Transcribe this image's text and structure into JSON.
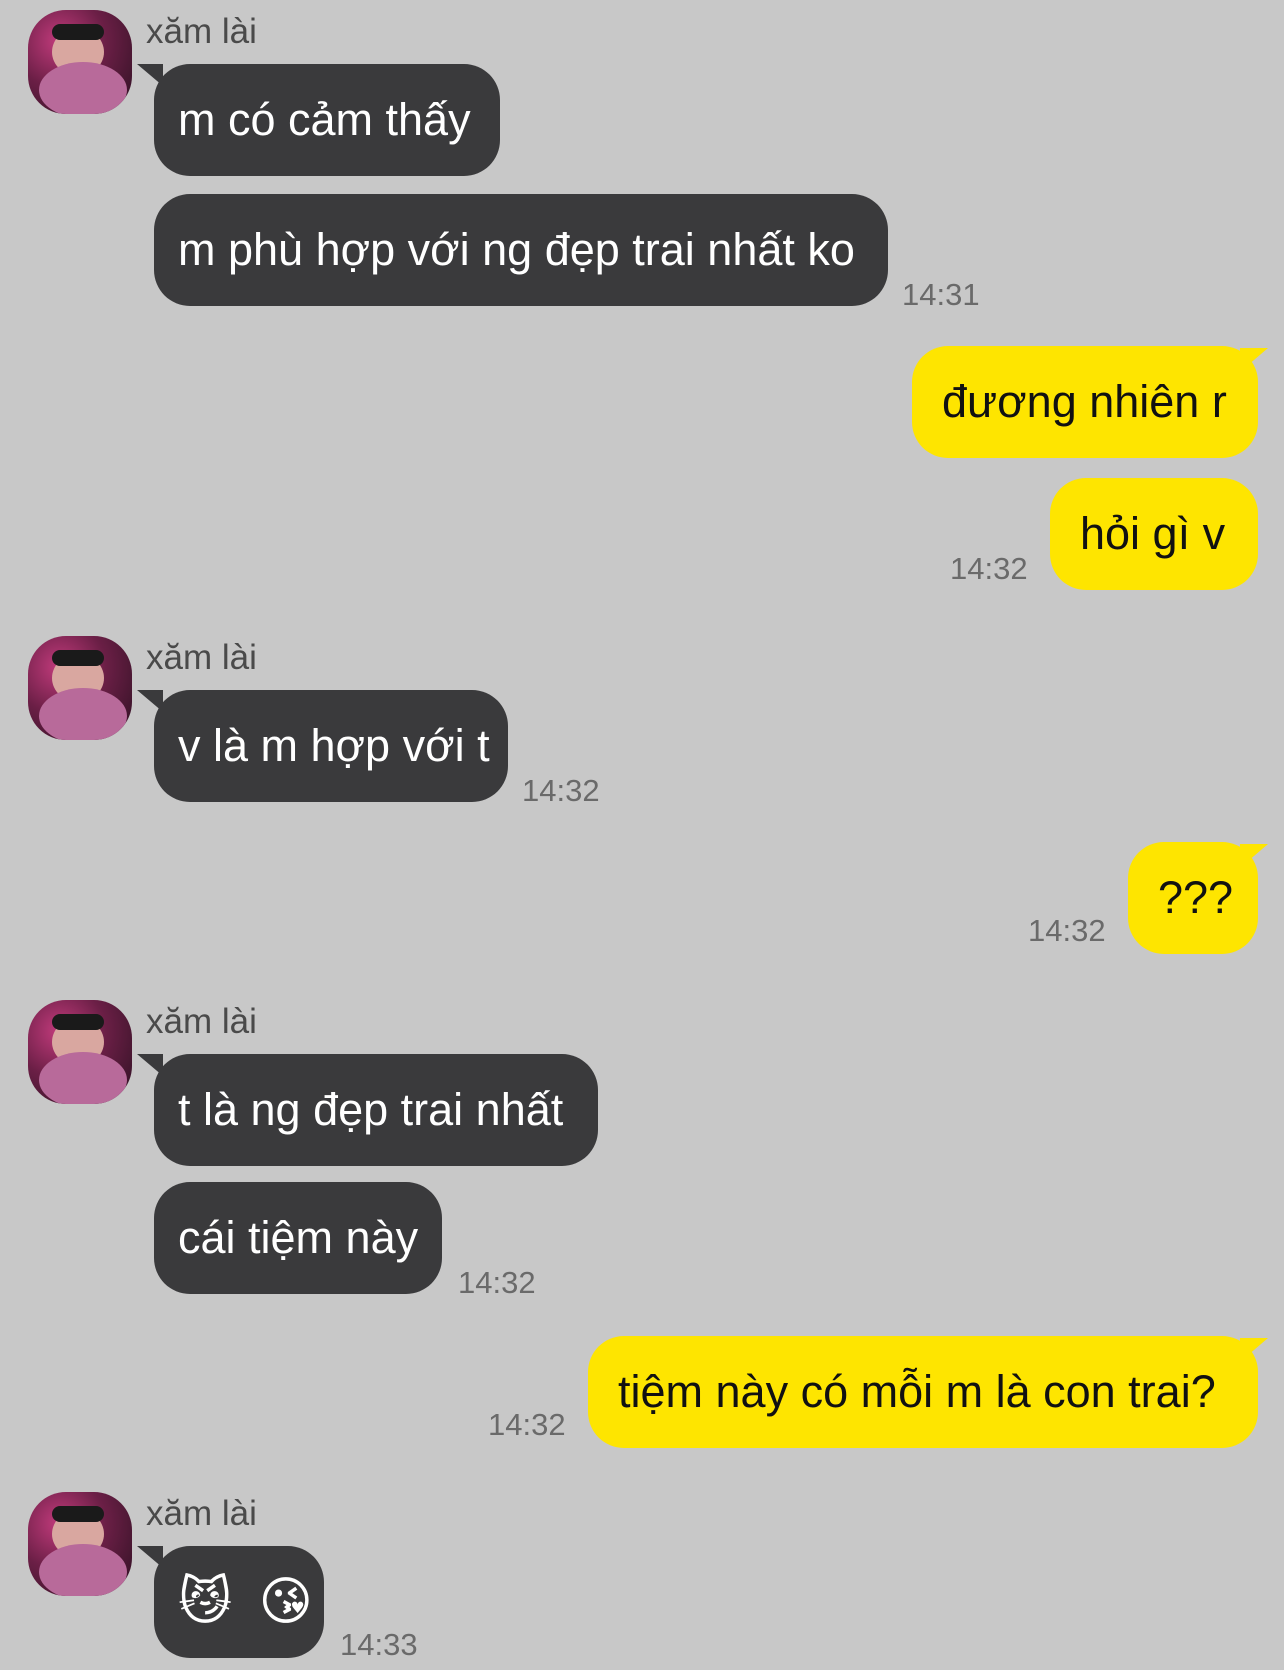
{
  "contact": {
    "name": "xăm lài"
  },
  "groups": [
    {
      "messages": [
        "m có cảm thấy",
        "m phù hợp với ng đẹp trai nhất ko"
      ],
      "time": "14:31"
    },
    {
      "messages": [
        "đương nhiên r",
        "hỏi gì v"
      ],
      "time": "14:32"
    },
    {
      "messages": [
        "v là m hợp với t"
      ],
      "time": "14:32"
    },
    {
      "messages": [
        "???"
      ],
      "time": "14:32"
    },
    {
      "messages": [
        "t là ng đẹp trai nhất",
        "cái tiệm này"
      ],
      "time": "14:32"
    },
    {
      "messages": [
        "tiệm này có mỗi m là con trai?"
      ],
      "time": "14:32"
    },
    {
      "messages": [
        "😼 😘"
      ],
      "time": "14:33"
    }
  ],
  "colors": {
    "background": "#c8c8c8",
    "incoming_bubble": "#3a3a3c",
    "outgoing_bubble": "#fee500"
  }
}
